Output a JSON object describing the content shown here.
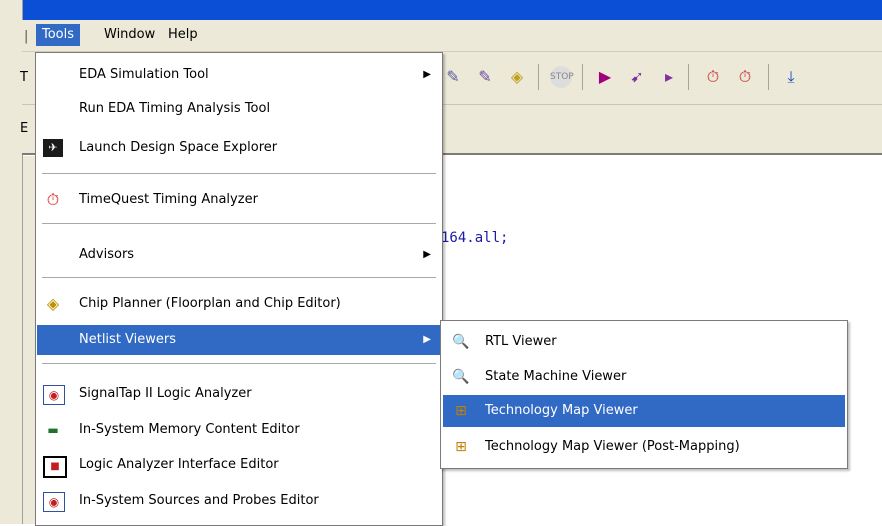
{
  "menubar": {
    "items": [
      {
        "label": "Tools"
      },
      {
        "label": "Window"
      },
      {
        "label": "Help"
      }
    ]
  },
  "side_fragments": {
    "toolbar_letter": "T",
    "tab_letter": "E",
    "menubar_pipe": "|"
  },
  "editor": {
    "code_fragment": "164.all;"
  },
  "tools_menu": {
    "items": [
      {
        "label": "EDA Simulation Tool",
        "icon": "none",
        "submenu": true
      },
      {
        "label": "Run EDA Timing Analysis Tool",
        "icon": "none",
        "submenu": false
      },
      {
        "label": "Launch Design Space Explorer",
        "icon": "dse-icon",
        "submenu": false
      },
      {
        "label": "TimeQuest Timing Analyzer",
        "icon": "stopwatch-icon",
        "submenu": false
      },
      {
        "label": "Advisors",
        "icon": "none",
        "submenu": true
      },
      {
        "label": "Chip Planner (Floorplan and Chip Editor)",
        "icon": "chip-planner-icon",
        "submenu": false
      },
      {
        "label": "Netlist Viewers",
        "icon": "none",
        "submenu": true
      },
      {
        "label": "SignalTap II Logic Analyzer",
        "icon": "signaltap-icon",
        "submenu": false
      },
      {
        "label": "In-System Memory Content Editor",
        "icon": "memory-icon",
        "submenu": false
      },
      {
        "label": "Logic Analyzer Interface Editor",
        "icon": "logic-analyzer-icon",
        "submenu": false
      },
      {
        "label": "In-System Sources and Probes Editor",
        "icon": "sources-probes-icon",
        "submenu": false
      }
    ]
  },
  "netlist_submenu": {
    "items": [
      {
        "label": "RTL Viewer",
        "icon": "rtl-viewer-icon"
      },
      {
        "label": "State Machine Viewer",
        "icon": "state-machine-icon"
      },
      {
        "label": "Technology Map Viewer",
        "icon": "tech-map-icon"
      },
      {
        "label": "Technology Map Viewer (Post-Mapping)",
        "icon": "tech-map-post-icon"
      }
    ]
  },
  "colors": {
    "highlight": "#316ac5",
    "chrome": "#ece9d8",
    "code": "#1a1aa8"
  }
}
